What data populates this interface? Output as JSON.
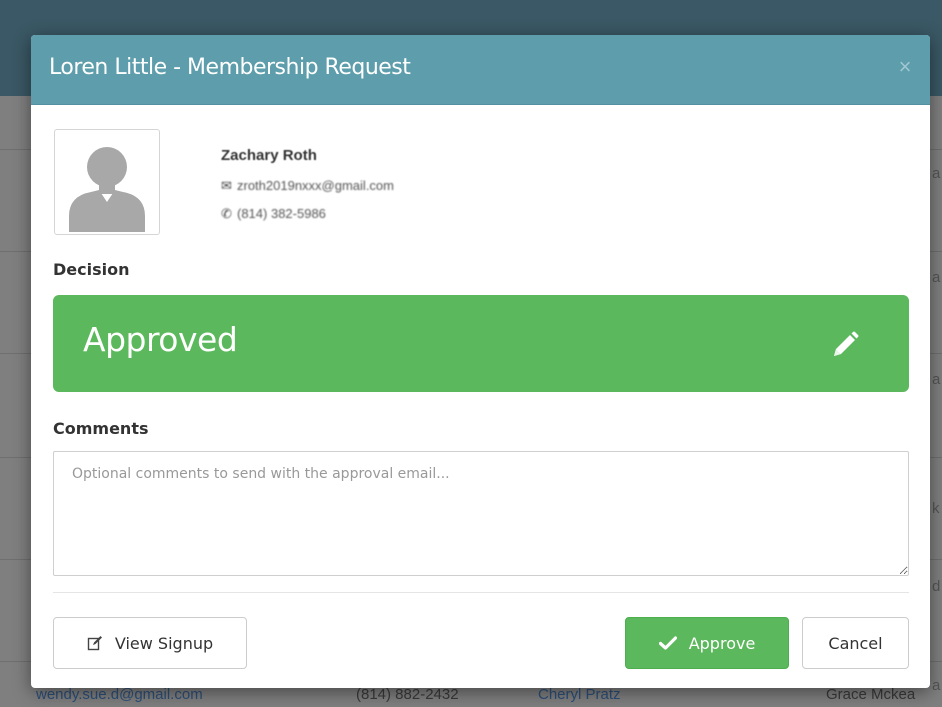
{
  "background": {
    "row_texts": [
      "wendy.sue.d@gmail.com",
      "(814) 882-2432",
      "Cheryl Pratz",
      "Grace Mckea"
    ],
    "edge_chars": [
      "a",
      "a",
      "a",
      "k",
      "d",
      "a"
    ]
  },
  "modal": {
    "title": "Loren Little - Membership Request",
    "close_label": "×",
    "member": {
      "name": "Zachary Roth",
      "email": "zroth2019nxxx@gmail.com",
      "phone": "(814) 382-5986"
    },
    "decision": {
      "label": "Decision",
      "value": "Approved"
    },
    "comments": {
      "label": "Comments",
      "placeholder": "Optional comments to send with the approval email...",
      "value": ""
    },
    "buttons": {
      "view_signup": "View Signup",
      "approve": "Approve",
      "cancel": "Cancel"
    }
  },
  "colors": {
    "header": "#5e9dac",
    "success": "#5cb85c",
    "backdrop": "#7f7f7f"
  }
}
